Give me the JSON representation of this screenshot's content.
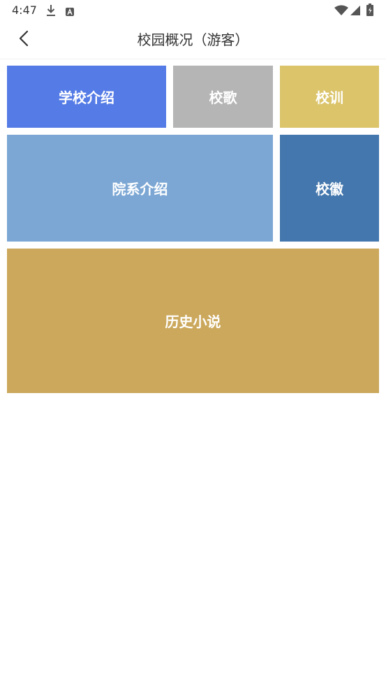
{
  "status_bar": {
    "time": "4:47",
    "icons": [
      "download-icon",
      "a-badge-icon",
      "wifi-icon",
      "signal-icon",
      "battery-charging-icon"
    ]
  },
  "app_bar": {
    "title": "校园概况（游客）",
    "back_icon": "chevron-left-icon"
  },
  "tiles": [
    {
      "label": "学校介绍",
      "color": "#547BE6"
    },
    {
      "label": "校歌",
      "color": "#B5B5B5"
    },
    {
      "label": "校训",
      "color": "#DBC46A"
    },
    {
      "label": "院系介绍",
      "color": "#7CA7D4"
    },
    {
      "label": "校徽",
      "color": "#4377AD"
    },
    {
      "label": "历史小说",
      "color": "#CBA85C"
    }
  ]
}
